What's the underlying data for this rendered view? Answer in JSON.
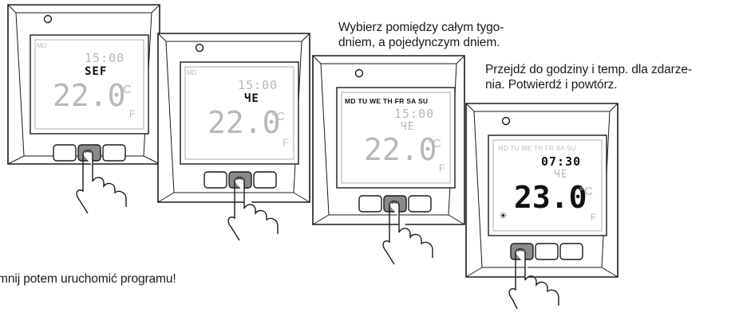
{
  "captions": {
    "select_line1": "Wybierz pomiędzy całym tygo-",
    "select_line2": "dniem, a pojedynczym dniem.",
    "goto_line1": "Przejdź do godziny i temp. dla zdarze-",
    "goto_line2": "nia. Potwierdź i powtórz.",
    "remember": "pomnij potem uruchomić programu!"
  },
  "devices": [
    {
      "mode": "MD",
      "time": "15:00",
      "day": "SEF",
      "temp": "22.0",
      "unit": "°C",
      "flag": "F"
    },
    {
      "mode": "MD",
      "time": "15:00",
      "day": "ЧE",
      "temp": "22.0",
      "unit": "°C",
      "flag": "F"
    },
    {
      "days": "MD TU WE TH FR SA SU",
      "time": "15:00",
      "day": "ЧE",
      "temp": "22.0",
      "unit": "°C",
      "flag": "F"
    },
    {
      "days": "MD TU WE TH FR SA SU",
      "time": "07:30",
      "day": "ЧE",
      "temp": "23.0",
      "unit": "°C",
      "flag": "F",
      "sun": "☀"
    }
  ],
  "colors": {
    "outline": "#1a1a1a",
    "lcd_dim": "#b8b8b8",
    "lcd_on": "#111111",
    "button_pressed": "#8a8a8a"
  }
}
